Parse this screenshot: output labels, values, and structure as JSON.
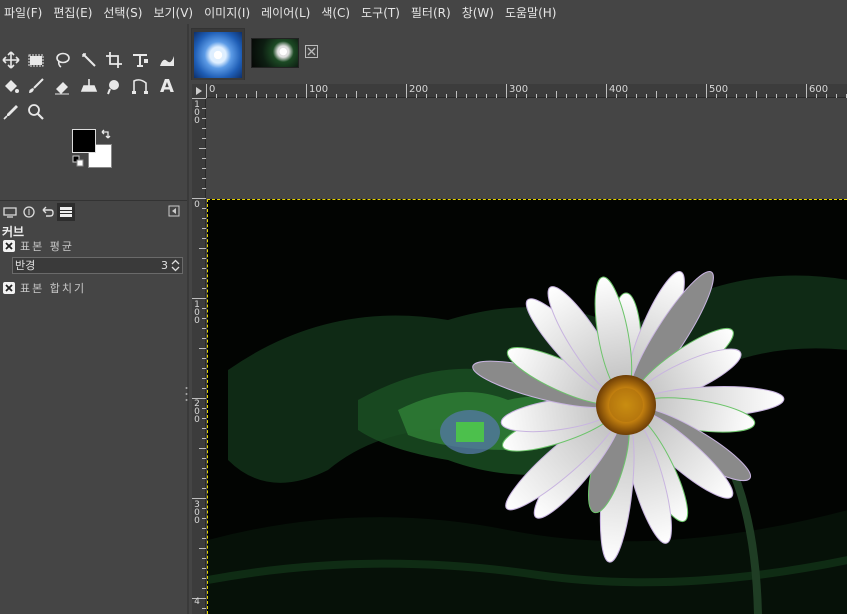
{
  "menubar": {
    "items": [
      {
        "label": "파일(F)"
      },
      {
        "label": "편집(E)"
      },
      {
        "label": "선택(S)"
      },
      {
        "label": "보기(V)"
      },
      {
        "label": "이미지(I)"
      },
      {
        "label": "레이어(L)"
      },
      {
        "label": "색(C)"
      },
      {
        "label": "도구(T)"
      },
      {
        "label": "필터(R)"
      },
      {
        "label": "창(W)"
      },
      {
        "label": "도움말(H)"
      }
    ]
  },
  "toolbox": {
    "tools": [
      {
        "icon": "move-icon"
      },
      {
        "icon": "rect-select-icon"
      },
      {
        "icon": "lasso-icon"
      },
      {
        "icon": "fuzzy-select-icon"
      },
      {
        "icon": "crop-icon"
      },
      {
        "icon": "transform-icon"
      },
      {
        "icon": "warp-icon"
      },
      {
        "icon": "bucket-fill-icon"
      },
      {
        "icon": "paintbrush-icon"
      },
      {
        "icon": "eraser-icon"
      },
      {
        "icon": "clone-icon"
      },
      {
        "icon": "smudge-icon"
      },
      {
        "icon": "paths-icon"
      },
      {
        "icon": "text-icon",
        "glyph": "A"
      },
      {
        "icon": "color-picker-icon"
      },
      {
        "icon": "zoom-icon"
      }
    ],
    "fg_color": "#000000",
    "bg_color": "#ffffff"
  },
  "curves_panel": {
    "title": "커브",
    "filter_1_label": "표본 평균",
    "radius_label": "반경",
    "radius_value": "3",
    "filter_2_label": "표본 합치기"
  },
  "rulers": {
    "horizontal": [
      "0",
      "100",
      "200",
      "300",
      "400",
      "500",
      "600"
    ],
    "vertical": [
      {
        "label": "1\n0\n0"
      },
      {
        "label": "0"
      },
      {
        "label": "1\n0\n0"
      },
      {
        "label": "2\n0\n0"
      },
      {
        "label": "3\n0\n0"
      },
      {
        "label": "4"
      }
    ]
  },
  "colors": {
    "selection_marquee": "#e8d400",
    "panel_bg": "#454545",
    "ruler_bg": "#3c3c3c"
  }
}
